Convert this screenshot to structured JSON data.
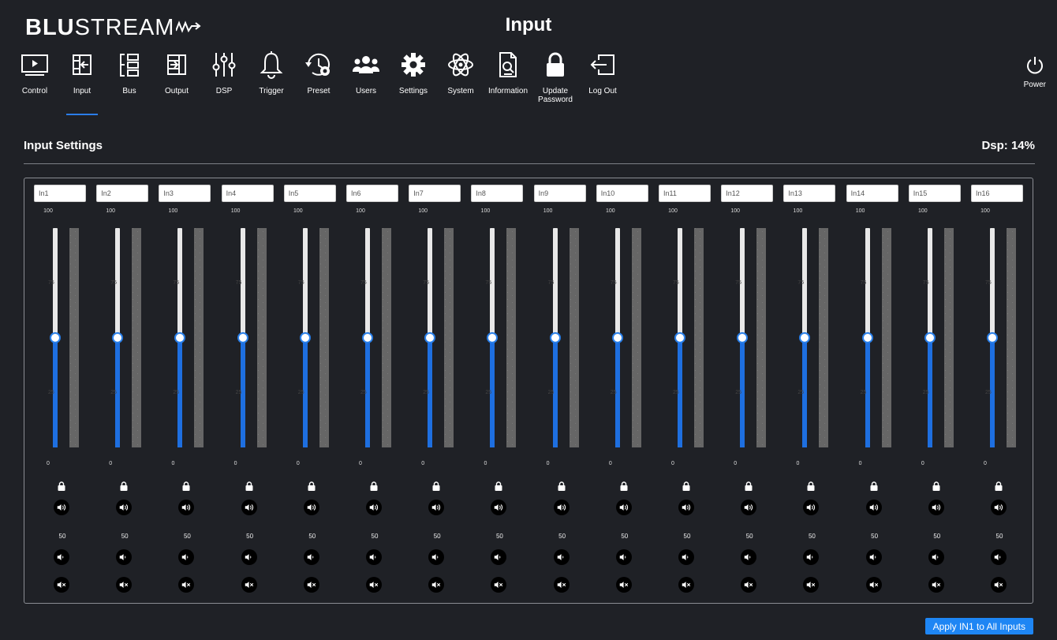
{
  "header": {
    "logo_bold": "BLU",
    "logo_rest": "STREAM",
    "title": "Input"
  },
  "nav": [
    {
      "label": "Control",
      "icon": "play-screen-icon"
    },
    {
      "label": "Input",
      "icon": "input-icon",
      "active": true
    },
    {
      "label": "Bus",
      "icon": "bus-icon"
    },
    {
      "label": "Output",
      "icon": "output-icon"
    },
    {
      "label": "DSP",
      "icon": "dsp-sliders-icon"
    },
    {
      "label": "Trigger",
      "icon": "bell-icon"
    },
    {
      "label": "Preset",
      "icon": "preset-icon"
    },
    {
      "label": "Users",
      "icon": "users-icon"
    },
    {
      "label": "Settings",
      "icon": "gear-icon"
    },
    {
      "label": "System",
      "icon": "atom-icon"
    },
    {
      "label": "Information",
      "icon": "information-icon"
    },
    {
      "label": "Update Password",
      "icon": "lock-icon"
    },
    {
      "label": "Log Out",
      "icon": "logout-icon"
    }
  ],
  "power_label": "Power",
  "section": {
    "title": "Input Settings",
    "dsp": "Dsp: 14%"
  },
  "scale": {
    "top": "100",
    "t75": "75",
    "t25": "25",
    "bottom": "0"
  },
  "channels": [
    {
      "name": "In1",
      "level": 50,
      "preset": "50"
    },
    {
      "name": "In2",
      "level": 50,
      "preset": "50"
    },
    {
      "name": "In3",
      "level": 50,
      "preset": "50"
    },
    {
      "name": "In4",
      "level": 50,
      "preset": "50"
    },
    {
      "name": "In5",
      "level": 50,
      "preset": "50"
    },
    {
      "name": "In6",
      "level": 50,
      "preset": "50"
    },
    {
      "name": "In7",
      "level": 50,
      "preset": "50"
    },
    {
      "name": "In8",
      "level": 50,
      "preset": "50"
    },
    {
      "name": "In9",
      "level": 50,
      "preset": "50"
    },
    {
      "name": "In10",
      "level": 50,
      "preset": "50"
    },
    {
      "name": "In11",
      "level": 50,
      "preset": "50"
    },
    {
      "name": "In12",
      "level": 50,
      "preset": "50"
    },
    {
      "name": "In13",
      "level": 50,
      "preset": "50"
    },
    {
      "name": "In14",
      "level": 50,
      "preset": "50"
    },
    {
      "name": "In15",
      "level": 50,
      "preset": "50"
    },
    {
      "name": "In16",
      "level": 50,
      "preset": "50"
    }
  ],
  "apply_button": "Apply IN1 to All Inputs",
  "colors": {
    "accent": "#1e6fe0",
    "background": "#1f2126",
    "button": "#1e86f4"
  }
}
